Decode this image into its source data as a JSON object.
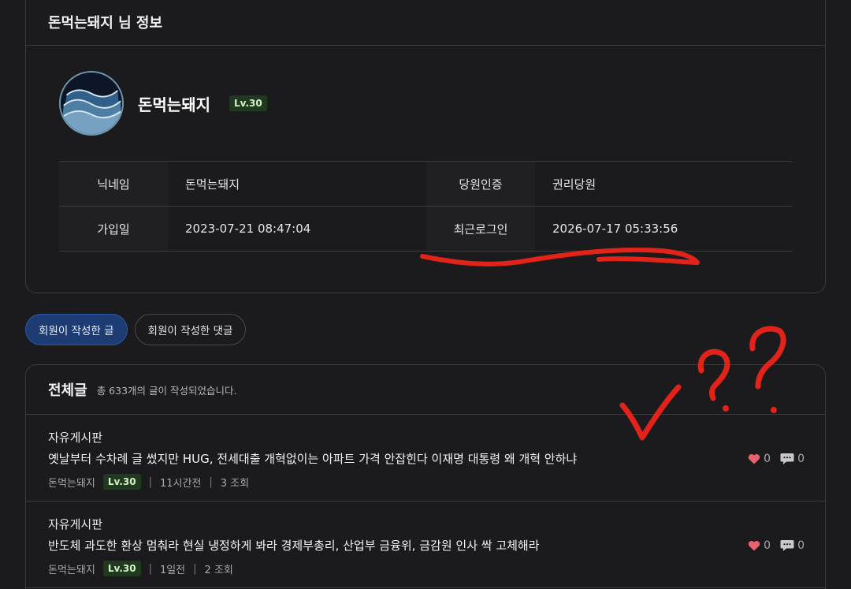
{
  "profile_card": {
    "title": "돈먹는돼지 님 정보",
    "name": "돈먹는돼지",
    "level": "Lv.30"
  },
  "info": {
    "row1": {
      "label1": "닉네임",
      "value1": "돈먹는돼지",
      "label2": "당원인증",
      "value2": "권리당원"
    },
    "row2": {
      "label1": "가입일",
      "value1": "2023-07-21 08:47:04",
      "label2": "최근로그인",
      "value2": "2026-07-17 05:33:56"
    }
  },
  "tabs": {
    "posts": "회원이 작성한 글",
    "comments": "회원이 작성한 댓글"
  },
  "posts_section": {
    "title": "전체글",
    "summary": "총 633개의 글이 작성되었습니다."
  },
  "posts": [
    {
      "board": "자유게시판",
      "title": "옛날부터 수차례 글 썼지만 HUG, 전세대출 개혁없이는 아파트 가격 안잡힌다 이재명 대통령 왜 개혁 안하냐",
      "author": "돈먹는돼지",
      "level": "Lv.30",
      "time": "11시간전",
      "views": "3 조회",
      "likes": "0",
      "comments": "0"
    },
    {
      "board": "자유게시판",
      "title": "반도체 과도한 환상 멈춰라 현실 냉정하게 봐라 경제부총리, 산업부 금융위, 금감원 인사 싹 고체해라",
      "author": "돈먹는돼지",
      "level": "Lv.30",
      "time": "1일전",
      "views": "2 조회",
      "likes": "0",
      "comments": "0"
    }
  ],
  "annotation_color": "#e2231a",
  "accent_color": "#1d3c74",
  "badge_color": "#1f3a1e",
  "heart_color": "#e8626d"
}
